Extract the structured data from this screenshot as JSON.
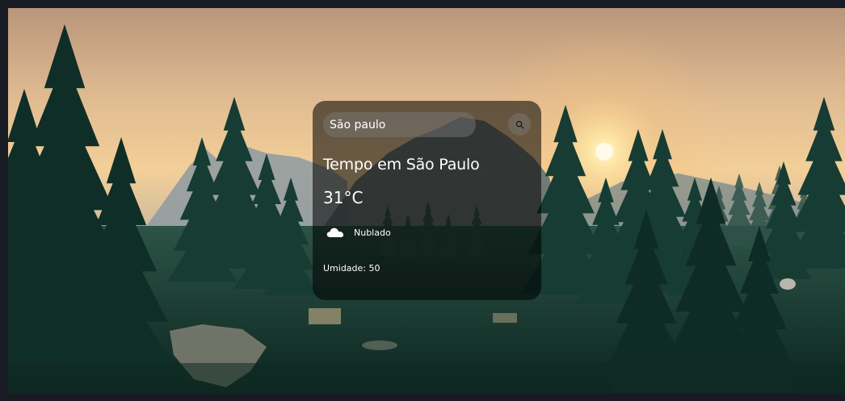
{
  "search": {
    "value": "São paulo",
    "icon": "search-icon"
  },
  "weather": {
    "title": "Tempo em São Paulo",
    "temperature": "31°C",
    "condition_icon": "cloud-icon",
    "condition": "Nublado",
    "humidity": "Umidade: 50"
  },
  "colors": {
    "card_bg": "rgba(0,0,0,0.56)",
    "text": "#ffffff",
    "page_border": "#181a24",
    "sky_top": "#cfa57e",
    "sun": "#fff4c8",
    "forest": "#12342c"
  }
}
